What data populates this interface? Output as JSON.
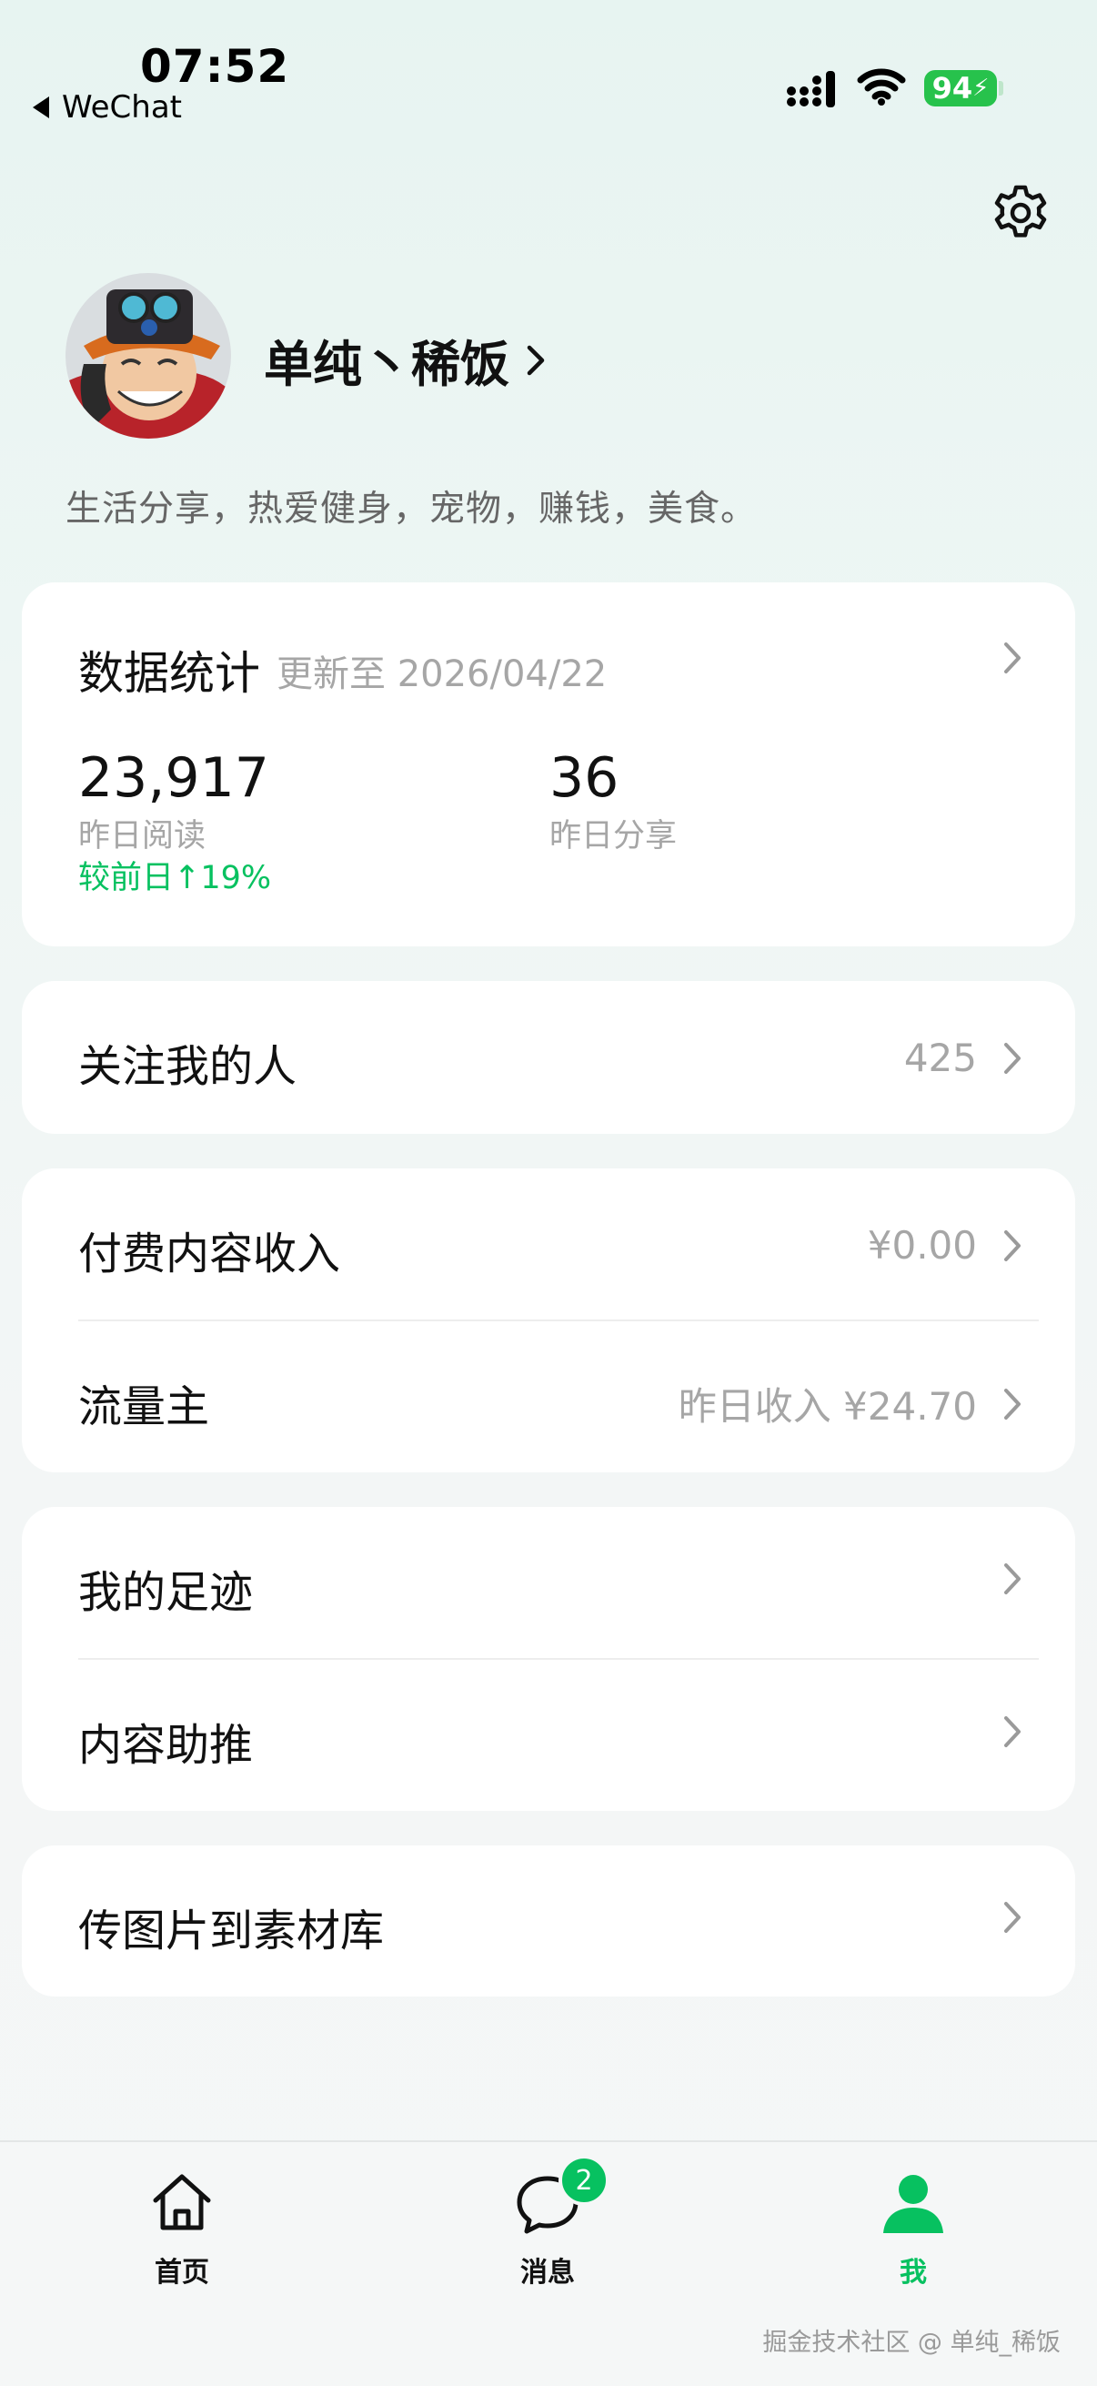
{
  "status_bar": {
    "time": "07:52",
    "back_app": "WeChat",
    "battery": "94"
  },
  "profile": {
    "username": "单纯丶稀饭",
    "bio": "生活分享，热爱健身，宠物，赚钱，美食。"
  },
  "stats": {
    "title": "数据统计",
    "updated": "更新至 2026/04/22",
    "reads_value": "23,917",
    "reads_label": "昨日阅读",
    "reads_change": "较前日↑19%",
    "shares_value": "36",
    "shares_label": "昨日分享"
  },
  "followers": {
    "label": "关注我的人",
    "value": "425"
  },
  "income": {
    "paid_label": "付费内容收入",
    "paid_value": "¥0.00",
    "traffic_label": "流量主",
    "traffic_value": "昨日收入 ¥24.70"
  },
  "tools": {
    "footprints": "我的足迹",
    "promote": "内容助推"
  },
  "upload": {
    "label": "传图片到素材库"
  },
  "tabbar": {
    "home": "首页",
    "messages": "消息",
    "messages_badge": "2",
    "me": "我"
  },
  "watermark": "掘金技术社区 @ 单纯_稀饭",
  "colors": {
    "accent": "#07c160",
    "battery": "#27c24c"
  },
  "icons": [
    "signal-icon",
    "wifi-icon",
    "battery-icon",
    "settings-icon",
    "chevron-right-icon",
    "home-icon",
    "chat-bubble-icon",
    "person-icon"
  ]
}
